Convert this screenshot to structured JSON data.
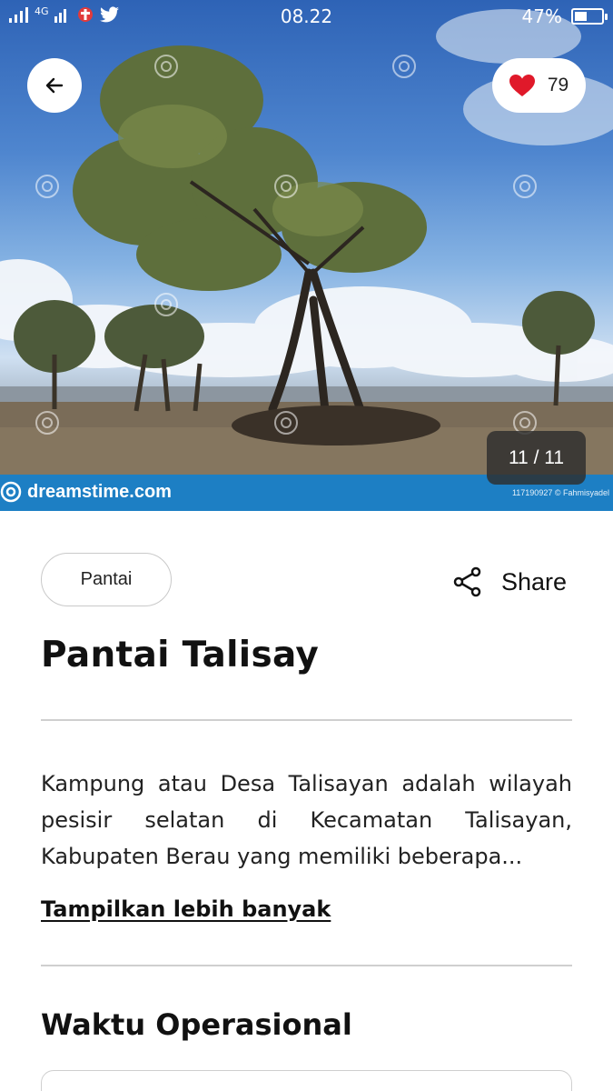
{
  "status_bar": {
    "network": "4G",
    "time": "08.22",
    "battery": "47%",
    "battery_level": 0.47
  },
  "hero": {
    "watermark": "dreamstime.com",
    "watermark_id": "117190927 © Fahmisyadel",
    "like_count": "79",
    "image_counter": "11 / 11"
  },
  "icons": {
    "back": "arrow-left-icon",
    "like": "heart-icon",
    "share": "share-icon"
  },
  "colors": {
    "heart": "#e0192a",
    "watermark_bar": "#1d7fc4"
  },
  "place": {
    "category": "Pantai",
    "share_label": "Share",
    "title": "Pantai Talisay",
    "description": "Kampung atau Desa Talisayan adalah wilayah pesisir selatan di Kecamatan Talisayan, Kabupaten Berau yang memiliki beberapa...",
    "show_more": "Tampilkan lebih banyak"
  },
  "operational": {
    "title": "Waktu Operasional"
  }
}
